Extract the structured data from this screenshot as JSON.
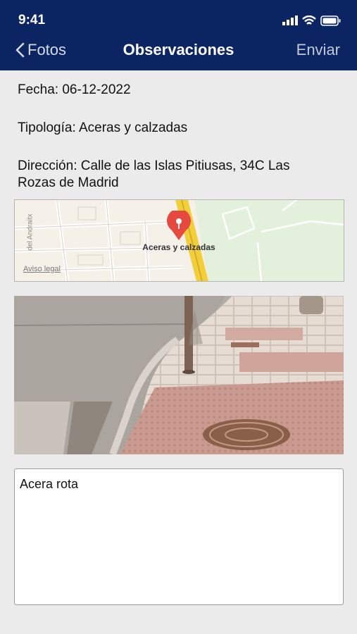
{
  "status": {
    "time": "9:41"
  },
  "nav": {
    "back_label": "Fotos",
    "title": "Observaciones",
    "send_label": "Enviar"
  },
  "details": {
    "fecha": "Fecha: 06-12-2022",
    "tipologia": "Tipología: Aceras y calzadas",
    "direccion": "Dirección: Calle de las Islas Pitiusas, 34C Las Rozas de Madrid"
  },
  "map": {
    "pin_label": "Aceras y calzadas",
    "street_label": "del Andraitx",
    "legal_link": "Aviso legal"
  },
  "notes": {
    "text": "Acera rota"
  },
  "colors": {
    "header": "#0b2563",
    "pin": "#e6493d",
    "road": "#f2cf3a"
  },
  "icons": [
    "signal-icon",
    "wifi-icon",
    "battery-icon",
    "chevron-left-icon",
    "map-pin-icon"
  ]
}
